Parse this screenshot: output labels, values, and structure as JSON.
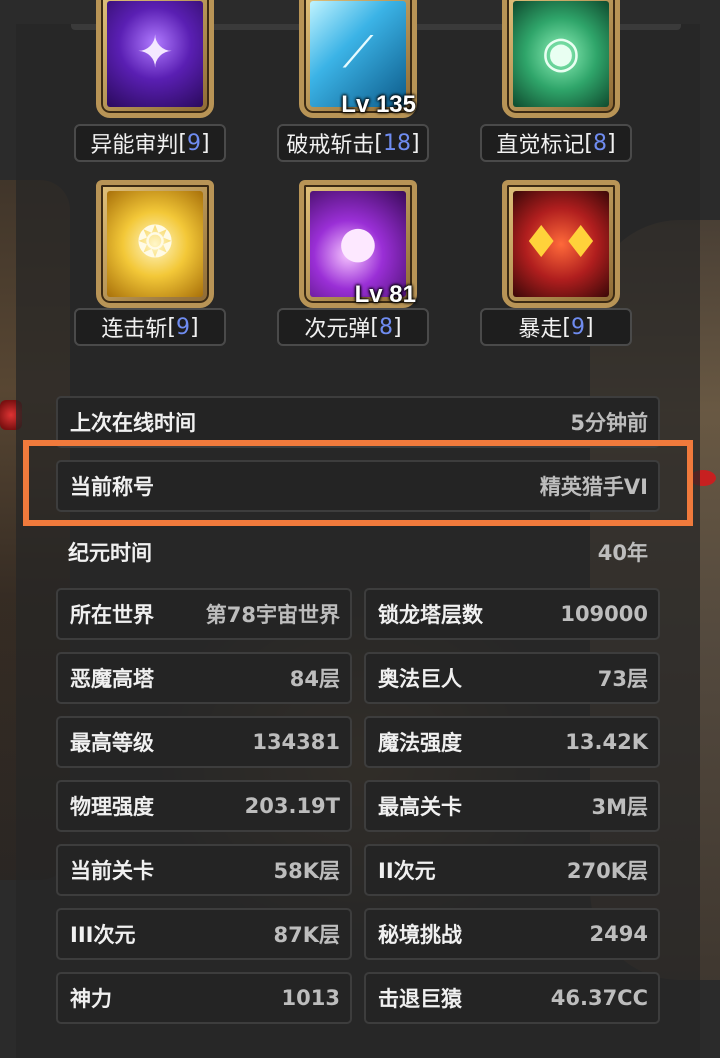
{
  "colors": {
    "highlight": "#f07a3c",
    "level_number": "#6f8cf0",
    "frame_gold": "#b89456"
  },
  "skills": [
    {
      "name": "异能审判",
      "count": "9",
      "level_badge": "",
      "icon": "purple-star-icon"
    },
    {
      "name": "破戒斩击",
      "count": "18",
      "level_badge": "Lv 135",
      "icon": "blue-slash-icon"
    },
    {
      "name": "直觉标记",
      "count": "8",
      "level_badge": "",
      "icon": "green-eye-icon"
    },
    {
      "name": "连击斩",
      "count": "9",
      "level_badge": "",
      "icon": "yellow-swirl-icon"
    },
    {
      "name": "次元弹",
      "count": "8",
      "level_badge": "Lv 81",
      "icon": "purple-orb-icon"
    },
    {
      "name": "暴走",
      "count": "9",
      "level_badge": "",
      "icon": "red-demon-face-icon"
    }
  ],
  "info": {
    "last_online": {
      "label": "上次在线时间",
      "value": "5分钟前"
    },
    "current_title": {
      "label": "当前称号",
      "value": "精英猎手VI"
    },
    "era_time": {
      "label": "纪元时间",
      "value": "40年"
    }
  },
  "stats": [
    {
      "left": {
        "label": "所在世界",
        "value": "第78宇宙世界"
      },
      "right": {
        "label": "锁龙塔层数",
        "value": "109000"
      }
    },
    {
      "left": {
        "label": "恶魔高塔",
        "value": "84层"
      },
      "right": {
        "label": "奥法巨人",
        "value": "73层"
      }
    },
    {
      "left": {
        "label": "最高等级",
        "value": "134381"
      },
      "right": {
        "label": "魔法强度",
        "value": "13.42K"
      }
    },
    {
      "left": {
        "label": "物理强度",
        "value": "203.19T"
      },
      "right": {
        "label": "最高关卡",
        "value": "3M层"
      }
    },
    {
      "left": {
        "label": "当前关卡",
        "value": "58K层"
      },
      "right": {
        "label": "II次元",
        "value": "270K层"
      }
    },
    {
      "left": {
        "label": "III次元",
        "value": "87K层"
      },
      "right": {
        "label": "秘境挑战",
        "value": "2494"
      }
    },
    {
      "left": {
        "label": "神力",
        "value": "1013"
      },
      "right": {
        "label": "击退巨猿",
        "value": "46.37CC"
      }
    }
  ]
}
